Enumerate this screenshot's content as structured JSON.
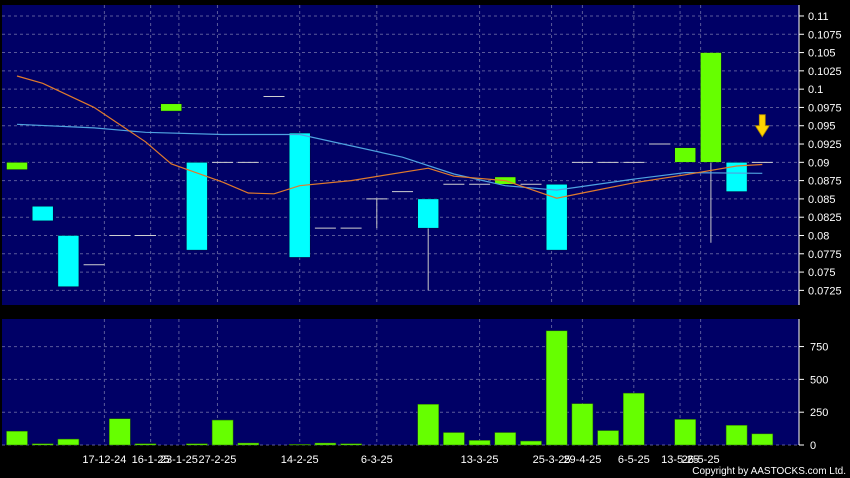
{
  "chart_data": [
    {
      "type": "candlestick",
      "panel": "price",
      "ylim": [
        0.0705,
        0.1115
      ],
      "y_ticks": [
        "0.11",
        "0.1075",
        "0.105",
        "0.1025",
        "0.1",
        "0.0975",
        "0.095",
        "0.0925",
        "0.09",
        "0.0875",
        "0.085",
        "0.0825",
        "0.08",
        "0.0775",
        "0.075",
        "0.0725"
      ],
      "candles": [
        {
          "open": 0.089,
          "close": 0.09,
          "high": 0.09,
          "low": 0.089
        },
        {
          "open": 0.084,
          "close": 0.082,
          "high": 0.084,
          "low": 0.082
        },
        {
          "open": 0.08,
          "close": 0.073,
          "high": 0.08,
          "low": 0.073
        },
        {
          "open": 0.076,
          "close": 0.076,
          "high": 0.076,
          "low": 0.076
        },
        {
          "open": 0.08,
          "close": 0.08,
          "high": 0.08,
          "low": 0.08
        },
        {
          "open": 0.08,
          "close": 0.08,
          "high": 0.08,
          "low": 0.08
        },
        {
          "open": 0.097,
          "close": 0.098,
          "high": 0.098,
          "low": 0.097
        },
        {
          "open": 0.09,
          "close": 0.078,
          "high": 0.09,
          "low": 0.078
        },
        {
          "open": 0.09,
          "close": 0.09,
          "high": 0.09,
          "low": 0.09
        },
        {
          "open": 0.09,
          "close": 0.09,
          "high": 0.09,
          "low": 0.09
        },
        {
          "open": 0.099,
          "close": 0.099,
          "high": 0.099,
          "low": 0.099
        },
        {
          "open": 0.094,
          "close": 0.077,
          "high": 0.094,
          "low": 0.077
        },
        {
          "open": 0.081,
          "close": 0.081,
          "high": 0.081,
          "low": 0.081
        },
        {
          "open": 0.081,
          "close": 0.081,
          "high": 0.081,
          "low": 0.081
        },
        {
          "open": 0.085,
          "close": 0.085,
          "high": 0.085,
          "low": 0.081
        },
        {
          "open": 0.086,
          "close": 0.086,
          "high": 0.086,
          "low": 0.086
        },
        {
          "open": 0.085,
          "close": 0.081,
          "high": 0.085,
          "low": 0.0725
        },
        {
          "open": 0.087,
          "close": 0.087,
          "high": 0.087,
          "low": 0.087
        },
        {
          "open": 0.087,
          "close": 0.087,
          "high": 0.087,
          "low": 0.087
        },
        {
          "open": 0.087,
          "close": 0.088,
          "high": 0.088,
          "low": 0.087
        },
        {
          "open": 0.087,
          "close": 0.087,
          "high": 0.087,
          "low": 0.087
        },
        {
          "open": 0.087,
          "close": 0.078,
          "high": 0.087,
          "low": 0.078
        },
        {
          "open": 0.09,
          "close": 0.09,
          "high": 0.09,
          "low": 0.09
        },
        {
          "open": 0.09,
          "close": 0.09,
          "high": 0.09,
          "low": 0.09
        },
        {
          "open": 0.09,
          "close": 0.09,
          "high": 0.09,
          "low": 0.09
        },
        {
          "open": 0.0925,
          "close": 0.0925,
          "high": 0.0925,
          "low": 0.0925
        },
        {
          "open": 0.09,
          "close": 0.092,
          "high": 0.092,
          "low": 0.09
        },
        {
          "open": 0.09,
          "close": 0.105,
          "high": 0.105,
          "low": 0.079
        },
        {
          "open": 0.09,
          "close": 0.086,
          "high": 0.09,
          "low": 0.086
        },
        {
          "open": 0.09,
          "close": 0.09,
          "high": 0.09,
          "low": 0.09
        }
      ],
      "ma_series": [
        {
          "color": "#4fa3e0",
          "points": [
            [
              0,
              0.0952
            ],
            [
              3,
              0.0947
            ],
            [
              5,
              0.0941
            ],
            [
              8,
              0.0938
            ],
            [
              11,
              0.0938
            ],
            [
              15,
              0.0907
            ],
            [
              17,
              0.0884
            ],
            [
              19,
              0.0868
            ],
            [
              21,
              0.0862
            ],
            [
              24,
              0.0877
            ],
            [
              26,
              0.0886
            ],
            [
              29,
              0.0885
            ]
          ]
        },
        {
          "color": "#e07a2c",
          "points": [
            [
              0,
              0.1018
            ],
            [
              1,
              0.1008
            ],
            [
              3,
              0.0975
            ],
            [
              5,
              0.0928
            ],
            [
              6,
              0.0898
            ],
            [
              8,
              0.0873
            ],
            [
              9,
              0.0858
            ],
            [
              10,
              0.0857
            ],
            [
              11,
              0.0868
            ],
            [
              13,
              0.0875
            ],
            [
              16,
              0.0892
            ],
            [
              17,
              0.0881
            ],
            [
              19,
              0.0875
            ],
            [
              21,
              0.0851
            ],
            [
              22,
              0.0858
            ],
            [
              24,
              0.0872
            ],
            [
              26,
              0.0883
            ],
            [
              28,
              0.0895
            ],
            [
              29,
              0.0897
            ]
          ]
        }
      ],
      "marker": {
        "type": "down-arrow",
        "color": "#ffd400",
        "at_value": 0.0935,
        "index": 29
      }
    },
    {
      "type": "bar",
      "panel": "volume",
      "ylim": [
        0,
        960
      ],
      "y_ticks": [
        "750",
        "500",
        "250",
        "0"
      ],
      "bar_color": "#66ff00",
      "values": [
        105,
        10,
        45,
        0,
        200,
        10,
        0,
        10,
        190,
        15,
        0,
        5,
        15,
        10,
        0,
        0,
        310,
        95,
        35,
        95,
        30,
        870,
        315,
        110,
        395,
        0,
        195,
        0,
        150,
        85
      ],
      "x_tick_labels": [
        {
          "index": 3.4,
          "label": "17-12-24"
        },
        {
          "index": 5.2,
          "label": "16-1-25"
        },
        {
          "index": 6.3,
          "label": "23-1-25"
        },
        {
          "index": 7.8,
          "label": "27-2-25"
        },
        {
          "index": 11.0,
          "label": "14-2-25"
        },
        {
          "index": 14.0,
          "label": "6-3-25"
        },
        {
          "index": 18.0,
          "label": "13-3-25"
        },
        {
          "index": 20.8,
          "label": "25-3-25"
        },
        {
          "index": 22.0,
          "label": "29-4-25"
        },
        {
          "index": 24.0,
          "label": "6-5-25"
        },
        {
          "index": 25.8,
          "label": "13-5-25"
        },
        {
          "index": 26.6,
          "label": "26-5-25"
        }
      ]
    }
  ],
  "copyright": "Copyright by AASTOCKS.com Ltd."
}
